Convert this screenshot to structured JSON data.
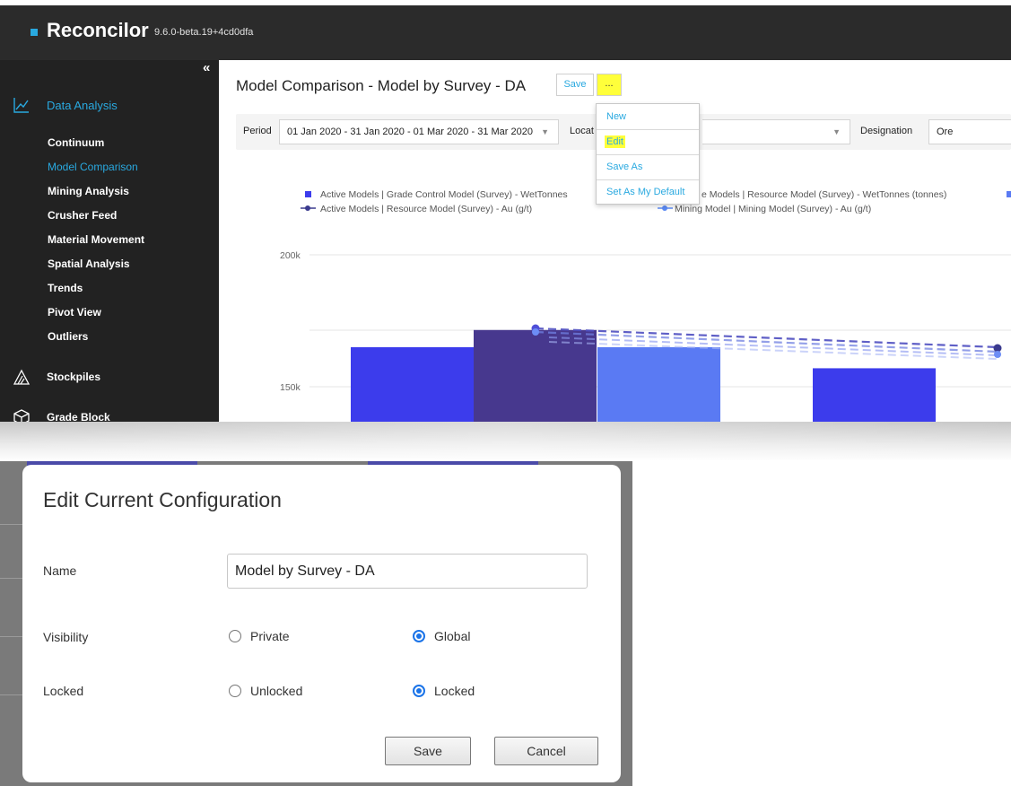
{
  "app": {
    "name": "Reconcilor",
    "version": "9.6.0-beta.19+4cd0dfa"
  },
  "sidebar": {
    "collapse_glyph": "«",
    "section_data": "Data Analysis",
    "items": [
      {
        "label": "Continuum",
        "active": false
      },
      {
        "label": "Model Comparison",
        "active": true
      },
      {
        "label": "Mining Analysis",
        "active": false
      },
      {
        "label": "Crusher Feed",
        "active": false
      },
      {
        "label": "Material Movement",
        "active": false
      },
      {
        "label": "Spatial Analysis",
        "active": false
      },
      {
        "label": "Trends",
        "active": false
      },
      {
        "label": "Pivot View",
        "active": false
      },
      {
        "label": "Outliers",
        "active": false
      }
    ],
    "section_stockpiles": "Stockpiles",
    "section_gradeblock": "Grade Block",
    "icons": {
      "data_analysis": "line-chart-icon",
      "stockpiles": "stockpile-icon",
      "gradeblock": "cube-icon"
    }
  },
  "header": {
    "title": "Model Comparison - Model by Survey - DA",
    "save_label": "Save",
    "more_label": "..."
  },
  "filters": {
    "period_label": "Period",
    "period_value": "01 Jan 2020 - 31 Jan 2020 - 01 Mar 2020 - 31 Mar 2020",
    "location_label": "Locat",
    "designation_label": "Designation",
    "designation_value": "Ore"
  },
  "menu": {
    "items": [
      "New",
      "Edit",
      "Save As",
      "Set As My Default"
    ],
    "highlighted": "Edit"
  },
  "legend": {
    "row1_a": "Active Models | Grade Control Model (Survey) - WetTonnes",
    "row1_b": "e Models | Resource Model (Survey) - WetTonnes (tonnes)",
    "row2_a": "Active Models | Resource Model (Survey) - Au (g/t)",
    "row2_b": "Mining Model | Mining Model (Survey) - Au (g/t)"
  },
  "chart_data": {
    "type": "bar",
    "ylim": [
      125000,
      210000
    ],
    "yticks": [
      {
        "value": 150000,
        "label": "150k"
      },
      {
        "value": 200000,
        "label": "200k"
      }
    ],
    "bars": [
      {
        "group": 0,
        "series": "Active Models | Grade Control Model (Survey) - WetTonnes",
        "value": 165000,
        "color": "#3c3cec"
      },
      {
        "group": 0,
        "series": "Active Models | Resource Model (Survey) - WetTonnes (tonnes)",
        "value": 171500,
        "color": "#47388e"
      },
      {
        "group": 0,
        "series": "Mining Model",
        "value": 165000,
        "color": "#5a7af3"
      },
      {
        "group": 1,
        "series": "Active Models | Grade Control Model (Survey) - WetTonnes",
        "value": 157000,
        "color": "#3c3cec"
      }
    ],
    "colors": {
      "bar1": "#3c3cec",
      "bar2": "#47388e",
      "bar3": "#5a7af3",
      "line1": "#3a3a8e",
      "line2": "#5b8af5"
    }
  },
  "dialog": {
    "title": "Edit Current Configuration",
    "name_label": "Name",
    "name_value": "Model by Survey - DA",
    "visibility_label": "Visibility",
    "visibility_options": [
      "Private",
      "Global"
    ],
    "visibility_selected": "Global",
    "locked_label": "Locked",
    "locked_options": [
      "Unlocked",
      "Locked"
    ],
    "locked_selected": "Locked",
    "save_label": "Save",
    "cancel_label": "Cancel"
  }
}
